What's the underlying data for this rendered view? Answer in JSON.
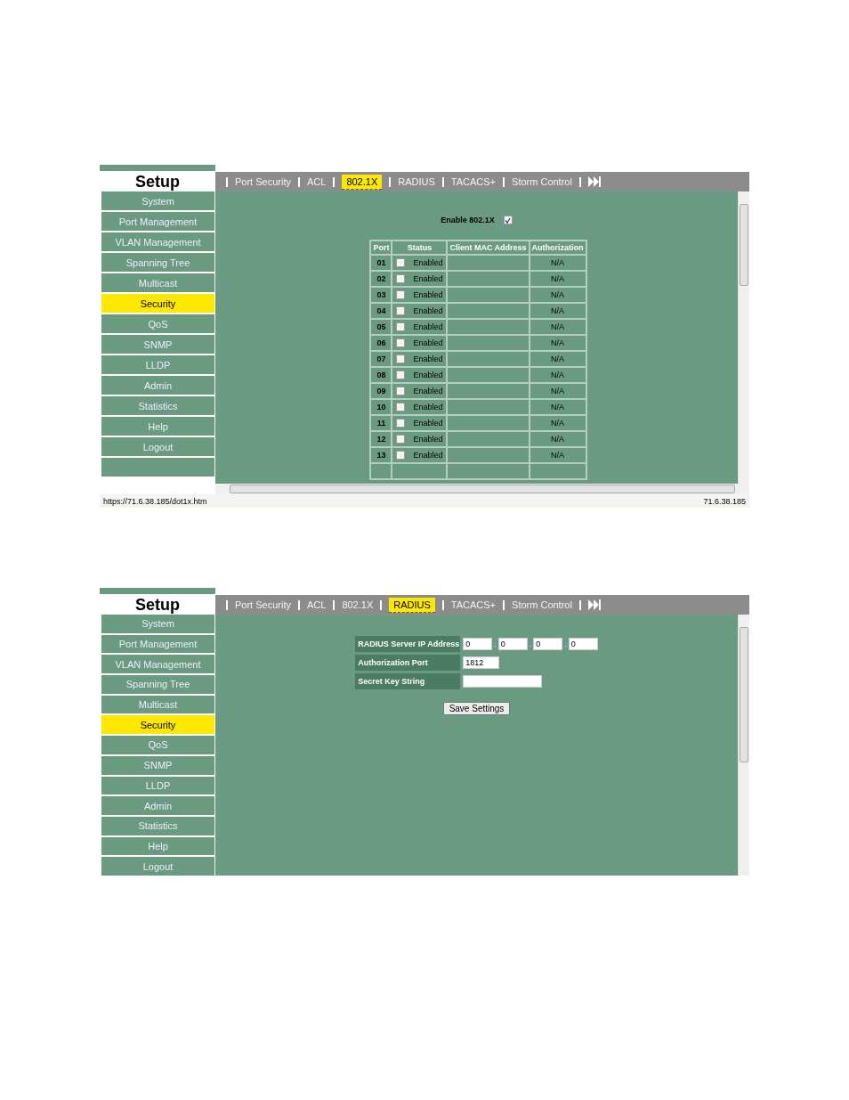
{
  "screens": [
    {
      "kind": "dot1x",
      "sidebar": {
        "title": "Setup",
        "items": [
          {
            "label": "System",
            "selected": false
          },
          {
            "label": "Port Management",
            "selected": false
          },
          {
            "label": "VLAN Management",
            "selected": false
          },
          {
            "label": "Spanning Tree",
            "selected": false
          },
          {
            "label": "Multicast",
            "selected": false
          },
          {
            "label": "Security",
            "selected": true
          },
          {
            "label": "QoS",
            "selected": false
          },
          {
            "label": "SNMP",
            "selected": false
          },
          {
            "label": "LLDP",
            "selected": false
          },
          {
            "label": "Admin",
            "selected": false
          },
          {
            "label": "Statistics",
            "selected": false
          },
          {
            "label": "Help",
            "selected": false
          },
          {
            "label": "Logout",
            "selected": false
          }
        ]
      },
      "tabs": [
        {
          "label": "Port Security",
          "selected": false
        },
        {
          "label": "ACL",
          "selected": false
        },
        {
          "label": "802.1X",
          "selected": true
        },
        {
          "label": "RADIUS",
          "selected": false
        },
        {
          "label": "TACACS+",
          "selected": false
        },
        {
          "label": "Storm Control",
          "selected": false
        }
      ],
      "enable": {
        "label": "Enable 802.1X",
        "checked": true
      },
      "table": {
        "columns": [
          "Port",
          "Status",
          "Client MAC Address",
          "Authorization"
        ],
        "rows": [
          {
            "port": "01",
            "status": "Enabled",
            "checked": false,
            "authorization": "N/A"
          },
          {
            "port": "02",
            "status": "Enabled",
            "checked": false,
            "authorization": "N/A"
          },
          {
            "port": "03",
            "status": "Enabled",
            "checked": false,
            "authorization": "N/A"
          },
          {
            "port": "04",
            "status": "Enabled",
            "checked": false,
            "authorization": "N/A"
          },
          {
            "port": "05",
            "status": "Enabled",
            "checked": false,
            "authorization": "N/A"
          },
          {
            "port": "06",
            "status": "Enabled",
            "checked": false,
            "authorization": "N/A"
          },
          {
            "port": "07",
            "status": "Enabled",
            "checked": false,
            "authorization": "N/A"
          },
          {
            "port": "08",
            "status": "Enabled",
            "checked": false,
            "authorization": "N/A"
          },
          {
            "port": "09",
            "status": "Enabled",
            "checked": false,
            "authorization": "N/A"
          },
          {
            "port": "10",
            "status": "Enabled",
            "checked": false,
            "authorization": "N/A"
          },
          {
            "port": "11",
            "status": "Enabled",
            "checked": false,
            "authorization": "N/A"
          },
          {
            "port": "12",
            "status": "Enabled",
            "checked": false,
            "authorization": "N/A"
          },
          {
            "port": "13",
            "status": "Enabled",
            "checked": false,
            "authorization": "N/A"
          }
        ]
      },
      "status_bar": {
        "url": "https://71.6.38.185/dot1x.htm",
        "host": "71.6.38.185"
      }
    },
    {
      "kind": "radius",
      "sidebar": {
        "title": "Setup",
        "items": [
          {
            "label": "System",
            "selected": false
          },
          {
            "label": "Port Management",
            "selected": false
          },
          {
            "label": "VLAN Management",
            "selected": false
          },
          {
            "label": "Spanning Tree",
            "selected": false
          },
          {
            "label": "Multicast",
            "selected": false
          },
          {
            "label": "Security",
            "selected": true
          },
          {
            "label": "QoS",
            "selected": false
          },
          {
            "label": "SNMP",
            "selected": false
          },
          {
            "label": "LLDP",
            "selected": false
          },
          {
            "label": "Admin",
            "selected": false
          },
          {
            "label": "Statistics",
            "selected": false
          },
          {
            "label": "Help",
            "selected": false
          },
          {
            "label": "Logout",
            "selected": false
          }
        ]
      },
      "tabs": [
        {
          "label": "Port Security",
          "selected": false
        },
        {
          "label": "ACL",
          "selected": false
        },
        {
          "label": "802.1X",
          "selected": false
        },
        {
          "label": "RADIUS",
          "selected": true
        },
        {
          "label": "TACACS+",
          "selected": false
        },
        {
          "label": "Storm Control",
          "selected": false
        }
      ],
      "fields": [
        {
          "label": "RADIUS Server IP Address",
          "kind": "ip",
          "separator": ".",
          "values": [
            "0",
            "0",
            "0",
            "0"
          ]
        },
        {
          "label": "Authorization Port",
          "kind": "text",
          "values": [
            "1812"
          ]
        },
        {
          "label": "Secret Key String",
          "kind": "secret"
        }
      ],
      "button": "Save Settings"
    }
  ]
}
